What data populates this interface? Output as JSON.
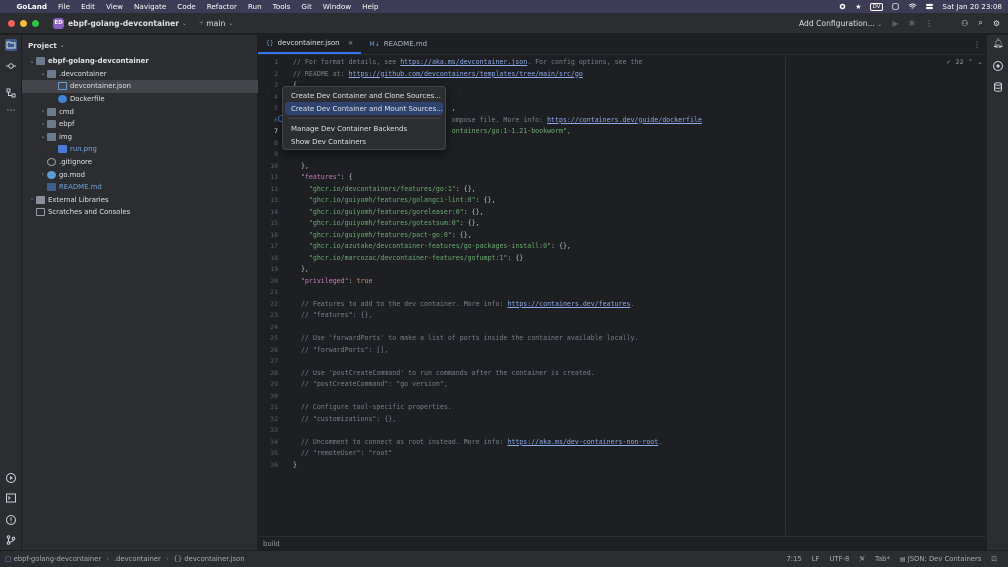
{
  "menubar": {
    "apple": "",
    "app_name": "GoLand",
    "items": [
      "File",
      "Edit",
      "View",
      "Navigate",
      "Code",
      "Refactor",
      "Run",
      "Tools",
      "Git",
      "Window",
      "Help"
    ],
    "clock": "Sat Jan 20  23:08",
    "badge": "DV"
  },
  "titlebar": {
    "project_badge": "ED",
    "project_name": "ebpf-golang-devcontainer",
    "branch": "main",
    "run_config": "Add Configuration..."
  },
  "project_panel": {
    "title": "Project",
    "tree": [
      {
        "label": "ebpf-golang-devcontainer",
        "depth": 0,
        "kind": "folder",
        "open": true,
        "bold": true
      },
      {
        "label": ".devcontainer",
        "depth": 1,
        "kind": "folder",
        "open": true
      },
      {
        "label": "devcontainer.json",
        "depth": 2,
        "kind": "json",
        "selected": true
      },
      {
        "label": "Dockerfile",
        "depth": 2,
        "kind": "docker"
      },
      {
        "label": "cmd",
        "depth": 1,
        "kind": "folder",
        "open": false
      },
      {
        "label": "ebpf",
        "depth": 1,
        "kind": "folder",
        "open": false
      },
      {
        "label": "img",
        "depth": 1,
        "kind": "folder",
        "open": true
      },
      {
        "label": "run.png",
        "depth": 2,
        "kind": "image"
      },
      {
        "label": ".gitignore",
        "depth": 1,
        "kind": "git"
      },
      {
        "label": "go.mod",
        "depth": 1,
        "kind": "gomod",
        "open": false
      },
      {
        "label": "README.md",
        "depth": 1,
        "kind": "md"
      },
      {
        "label": "External Libraries",
        "depth": 0,
        "kind": "lib",
        "open": false
      },
      {
        "label": "Scratches and Consoles",
        "depth": 0,
        "kind": "scratch"
      }
    ]
  },
  "editor": {
    "tabs": [
      {
        "label": "devcontainer.json",
        "active": true,
        "icon": "{}"
      },
      {
        "label": "README.md",
        "active": false,
        "icon": "M↓"
      }
    ],
    "inspection_count": "22",
    "lines": [
      [
        [
          "cm",
          "// For format details, see "
        ],
        [
          "url",
          "https://aka.ms/devcontainer.json"
        ],
        [
          "cm",
          ". For config options, see the"
        ]
      ],
      [
        [
          "cm",
          "// README at: "
        ],
        [
          "url",
          "https://github.com/devcontainers/templates/tree/main/src/go"
        ]
      ],
      [
        [
          "pun",
          "{"
        ]
      ],
      [
        [
          "pun",
          ""
        ]
      ],
      [
        [
          "pun",
          "                                        "
        ],
        [
          "pun",
          ","
        ]
      ],
      [
        [
          "pun",
          "                                        "
        ],
        [
          "cm",
          "ompose file. More info: "
        ],
        [
          "url",
          "https://containers.dev/guide/dockerfile"
        ]
      ],
      [
        [
          "pun",
          "                                        "
        ],
        [
          "str",
          "ontainers/go:1-1.21-bookworm\","
        ]
      ],
      [
        [
          "pun",
          ""
        ]
      ],
      [
        [
          "pun",
          ""
        ]
      ],
      [
        [
          "pun",
          "  },"
        ]
      ],
      [
        [
          "pun",
          "  "
        ],
        [
          "key",
          "\"features\""
        ],
        [
          "pun",
          ": {"
        ]
      ],
      [
        [
          "pun",
          "    "
        ],
        [
          "str",
          "\"ghcr.io/devcontainers/features/go:1\""
        ],
        [
          "pun",
          ": {},"
        ]
      ],
      [
        [
          "pun",
          "    "
        ],
        [
          "str",
          "\"ghcr.io/guiyomh/features/golangci-lint:0\""
        ],
        [
          "pun",
          ": {},"
        ]
      ],
      [
        [
          "pun",
          "    "
        ],
        [
          "str",
          "\"ghcr.io/guiyomh/features/goreleaser:0\""
        ],
        [
          "pun",
          ": {},"
        ]
      ],
      [
        [
          "pun",
          "    "
        ],
        [
          "str",
          "\"ghcr.io/guiyomh/features/gotestsum:0\""
        ],
        [
          "pun",
          ": {},"
        ]
      ],
      [
        [
          "pun",
          "    "
        ],
        [
          "str",
          "\"ghcr.io/guiyomh/features/pact-go:0\""
        ],
        [
          "pun",
          ": {},"
        ]
      ],
      [
        [
          "pun",
          "    "
        ],
        [
          "str",
          "\"ghcr.io/azutake/devcontainer-features/go-packages-install:0\""
        ],
        [
          "pun",
          ": {},"
        ]
      ],
      [
        [
          "pun",
          "    "
        ],
        [
          "str",
          "\"ghcr.io/marcozac/devcontainer-features/gofumpt:1\""
        ],
        [
          "pun",
          ": {}"
        ]
      ],
      [
        [
          "pun",
          "  },"
        ]
      ],
      [
        [
          "pun",
          "  "
        ],
        [
          "key",
          "\"privileged\""
        ],
        [
          "pun",
          ": "
        ],
        [
          "kw",
          "true"
        ]
      ],
      [
        [
          "pun",
          ""
        ]
      ],
      [
        [
          "pun",
          "  "
        ],
        [
          "cm",
          "// Features to add to the dev container. More info: "
        ],
        [
          "url",
          "https://containers.dev/features"
        ],
        [
          "cm",
          "."
        ]
      ],
      [
        [
          "pun",
          "  "
        ],
        [
          "cm",
          "// \"features\": {},"
        ]
      ],
      [
        [
          "pun",
          ""
        ]
      ],
      [
        [
          "pun",
          "  "
        ],
        [
          "cm",
          "// Use 'forwardPorts' to make a list of ports inside the container available locally."
        ]
      ],
      [
        [
          "pun",
          "  "
        ],
        [
          "cm",
          "// \"forwardPorts\": [],"
        ]
      ],
      [
        [
          "pun",
          ""
        ]
      ],
      [
        [
          "pun",
          "  "
        ],
        [
          "cm",
          "// Use 'postCreateCommand' to run commands after the container is created."
        ]
      ],
      [
        [
          "pun",
          "  "
        ],
        [
          "cm",
          "// \"postCreateCommand\": \"go version\","
        ]
      ],
      [
        [
          "pun",
          ""
        ]
      ],
      [
        [
          "pun",
          "  "
        ],
        [
          "cm",
          "// Configure tool-specific properties."
        ]
      ],
      [
        [
          "pun",
          "  "
        ],
        [
          "cm",
          "// \"customizations\": {},"
        ]
      ],
      [
        [
          "pun",
          ""
        ]
      ],
      [
        [
          "pun",
          "  "
        ],
        [
          "cm",
          "// Uncomment to connect as root instead. More info: "
        ],
        [
          "url",
          "https://aka.ms/dev-containers-non-root"
        ],
        [
          "cm",
          "."
        ]
      ],
      [
        [
          "pun",
          "  "
        ],
        [
          "cm",
          "// \"remoteUser\": \"root\""
        ]
      ],
      [
        [
          "pun",
          "}"
        ]
      ]
    ]
  },
  "popup": {
    "items": [
      {
        "label": "Create Dev Container and Clone Sources...",
        "highlighted": false
      },
      {
        "label": "Create Dev Container and Mount Sources...",
        "highlighted": true
      },
      {
        "label": "Manage Dev Container Backends",
        "highlighted": false
      },
      {
        "label": "Show Dev Containers",
        "highlighted": false
      }
    ]
  },
  "breadcrumb": {
    "text": "build"
  },
  "status": {
    "path": [
      "ebpf-golang-devcontainer",
      ".devcontainer",
      "devcontainer.json"
    ],
    "position": "7:15",
    "line_sep": "LF",
    "encoding": "UTF-8",
    "indent": "Tab*",
    "schema": "JSON: Dev Containers"
  },
  "colors": {
    "accent": "#3574f0",
    "selection": "#2e436e",
    "menubar": "#3d3b55"
  }
}
